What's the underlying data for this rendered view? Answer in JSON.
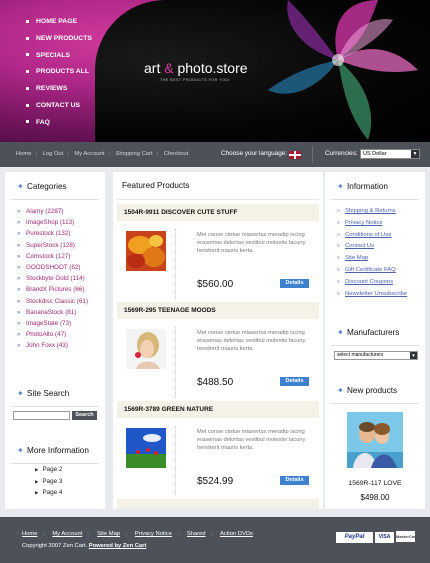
{
  "header": {
    "nav": [
      "HOME PAGE",
      "NEW PRODUCTS",
      "SPECIALS",
      "PRODUCTS ALL",
      "REVIEWS",
      "CONTACT US",
      "FAQ"
    ],
    "logo_part1": "art ",
    "logo_amp": "&",
    "logo_part2": " photo.store",
    "tagline": "THE BEST PRODUCTS FOR YOU!"
  },
  "topbar": {
    "links": [
      "Home",
      "Log Out",
      "My Account",
      "Shopping Cart",
      "Checkout"
    ],
    "language_label": "Choose your language:",
    "currencies_label": "Currencies:",
    "currency_value": "US Dollar"
  },
  "categories": {
    "title": "Categories",
    "items": [
      "Alamy (2287)",
      "ImageShop (113)",
      "Purestock (132)",
      "SuperStock (128)",
      "Comstock (127)",
      "GOODSHOOT (82)",
      "Stockbyte Gold (114)",
      "BrandX Pictures (66)",
      "Stockdisc Classic (61)",
      "BananaStock (81)",
      "ImageState (73)",
      "PhotoAlto (47)",
      "John Foxx (43)"
    ]
  },
  "site_search": {
    "title": "Site Search",
    "button": "Search"
  },
  "more_information": {
    "title": "More Information",
    "items": [
      "Page 2",
      "Page 3",
      "Page 4"
    ]
  },
  "featured": {
    "title": "Featured Products",
    "products": [
      {
        "title": "1504R-9911 DISCOVER CUTE STUFF",
        "desc": "Met conse ctetue miasertas meradip iscing erasemas delortas vestibul molestie lacuny hendrerit mauris kerta.",
        "price": "$560.00",
        "button": "Details"
      },
      {
        "title": "1569R-295 TEENAGE MOODS",
        "desc": "Met conse ctetue miasertas meradip iscing erasemas delortas vestibul molestie lacuny hendrerit mauris kerta.",
        "price": "$488.50",
        "button": "Details"
      },
      {
        "title": "1569R-3789 GREEN NATURE",
        "desc": "Met conse ctetue miasertas meradip iscing erasemas delortas vestibul molestie lacuny hendrerit mauris kerta.",
        "price": "$524.99",
        "button": "Details"
      }
    ]
  },
  "information": {
    "title": "Information",
    "items": [
      "Shipping & Returns",
      "Privacy Notice",
      "Conditions of Use",
      "Contact Us",
      "Site Map",
      "Gift Certificate FAQ",
      "Discount Coupons",
      "Newsletter Unsubscribe"
    ]
  },
  "manufacturers": {
    "title": "Manufacturers",
    "select_value": "select manufacturers"
  },
  "new_products": {
    "title": "New products",
    "name": "1569R-117 LOVE",
    "price": "$498.00"
  },
  "footer": {
    "links": [
      "Home",
      "My Account",
      "Site Map",
      "Privacy Notice",
      "Shared",
      "Action DVDs"
    ],
    "copyright": "Copyright  2007 Zen Cart.",
    "powered": "Powered by Zen Cart",
    "payment": [
      "PayPal",
      "VISA",
      "MasterCard"
    ]
  },
  "colors": {
    "header_pink": "#b02889",
    "bar_gray": "#4d5159",
    "link_purple": "#9a2874",
    "details_blue": "#3e82cf"
  }
}
